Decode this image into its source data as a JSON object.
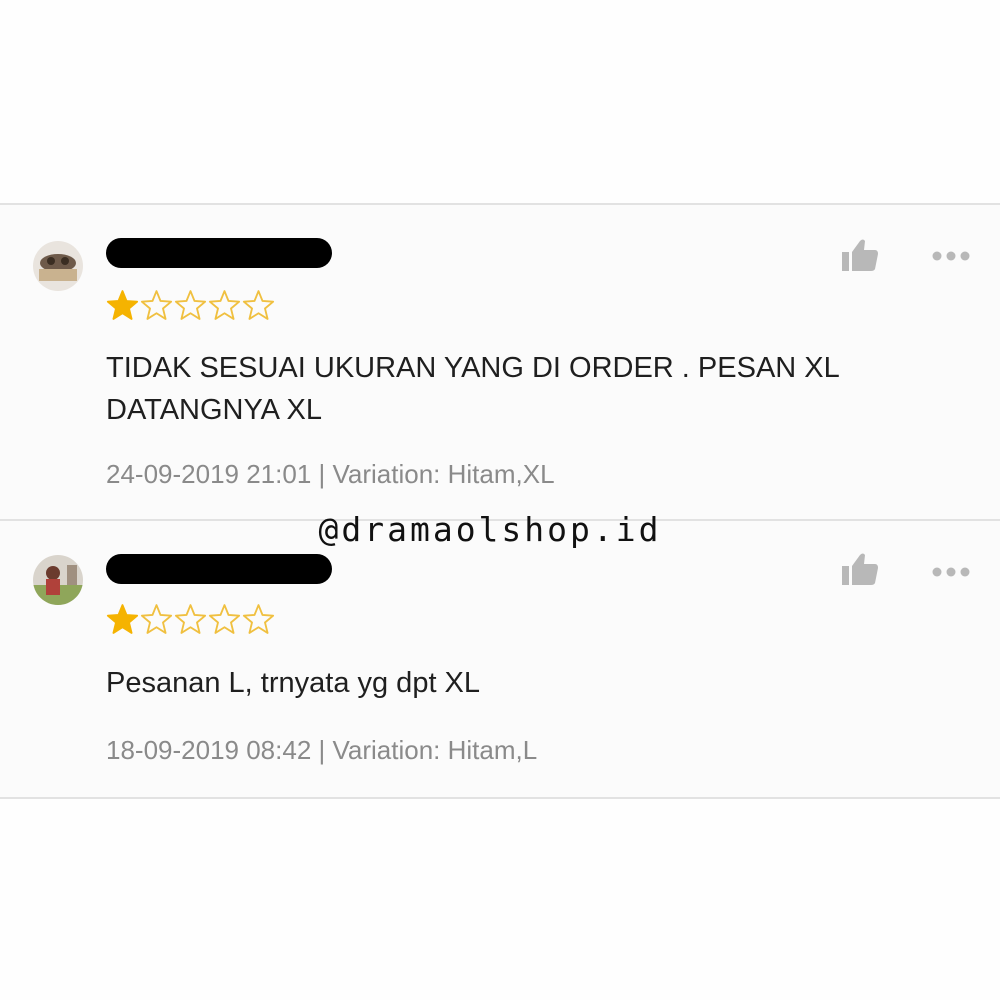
{
  "reviews": [
    {
      "rating": 1,
      "rating_max": 5,
      "text": "TIDAK SESUAI UKURAN YANG DI ORDER . PESAN XL\nDATANGNYA XL",
      "meta": "24-09-2019 21:01 | Variation: Hitam,XL"
    },
    {
      "rating": 1,
      "rating_max": 5,
      "text": "Pesanan L, trnyata yg dpt XL",
      "meta": "18-09-2019 08:42 | Variation: Hitam,L"
    }
  ],
  "watermark": "@dramaolshop.id",
  "icons": {
    "like": "thumbs-up-icon",
    "more": "more-options-icon",
    "star": "star-icon"
  },
  "colors": {
    "star_filled": "#f5b301",
    "star_empty": "#f0c040",
    "meta_text": "#8a8a8a",
    "icon_gray": "#b5b5b5"
  }
}
